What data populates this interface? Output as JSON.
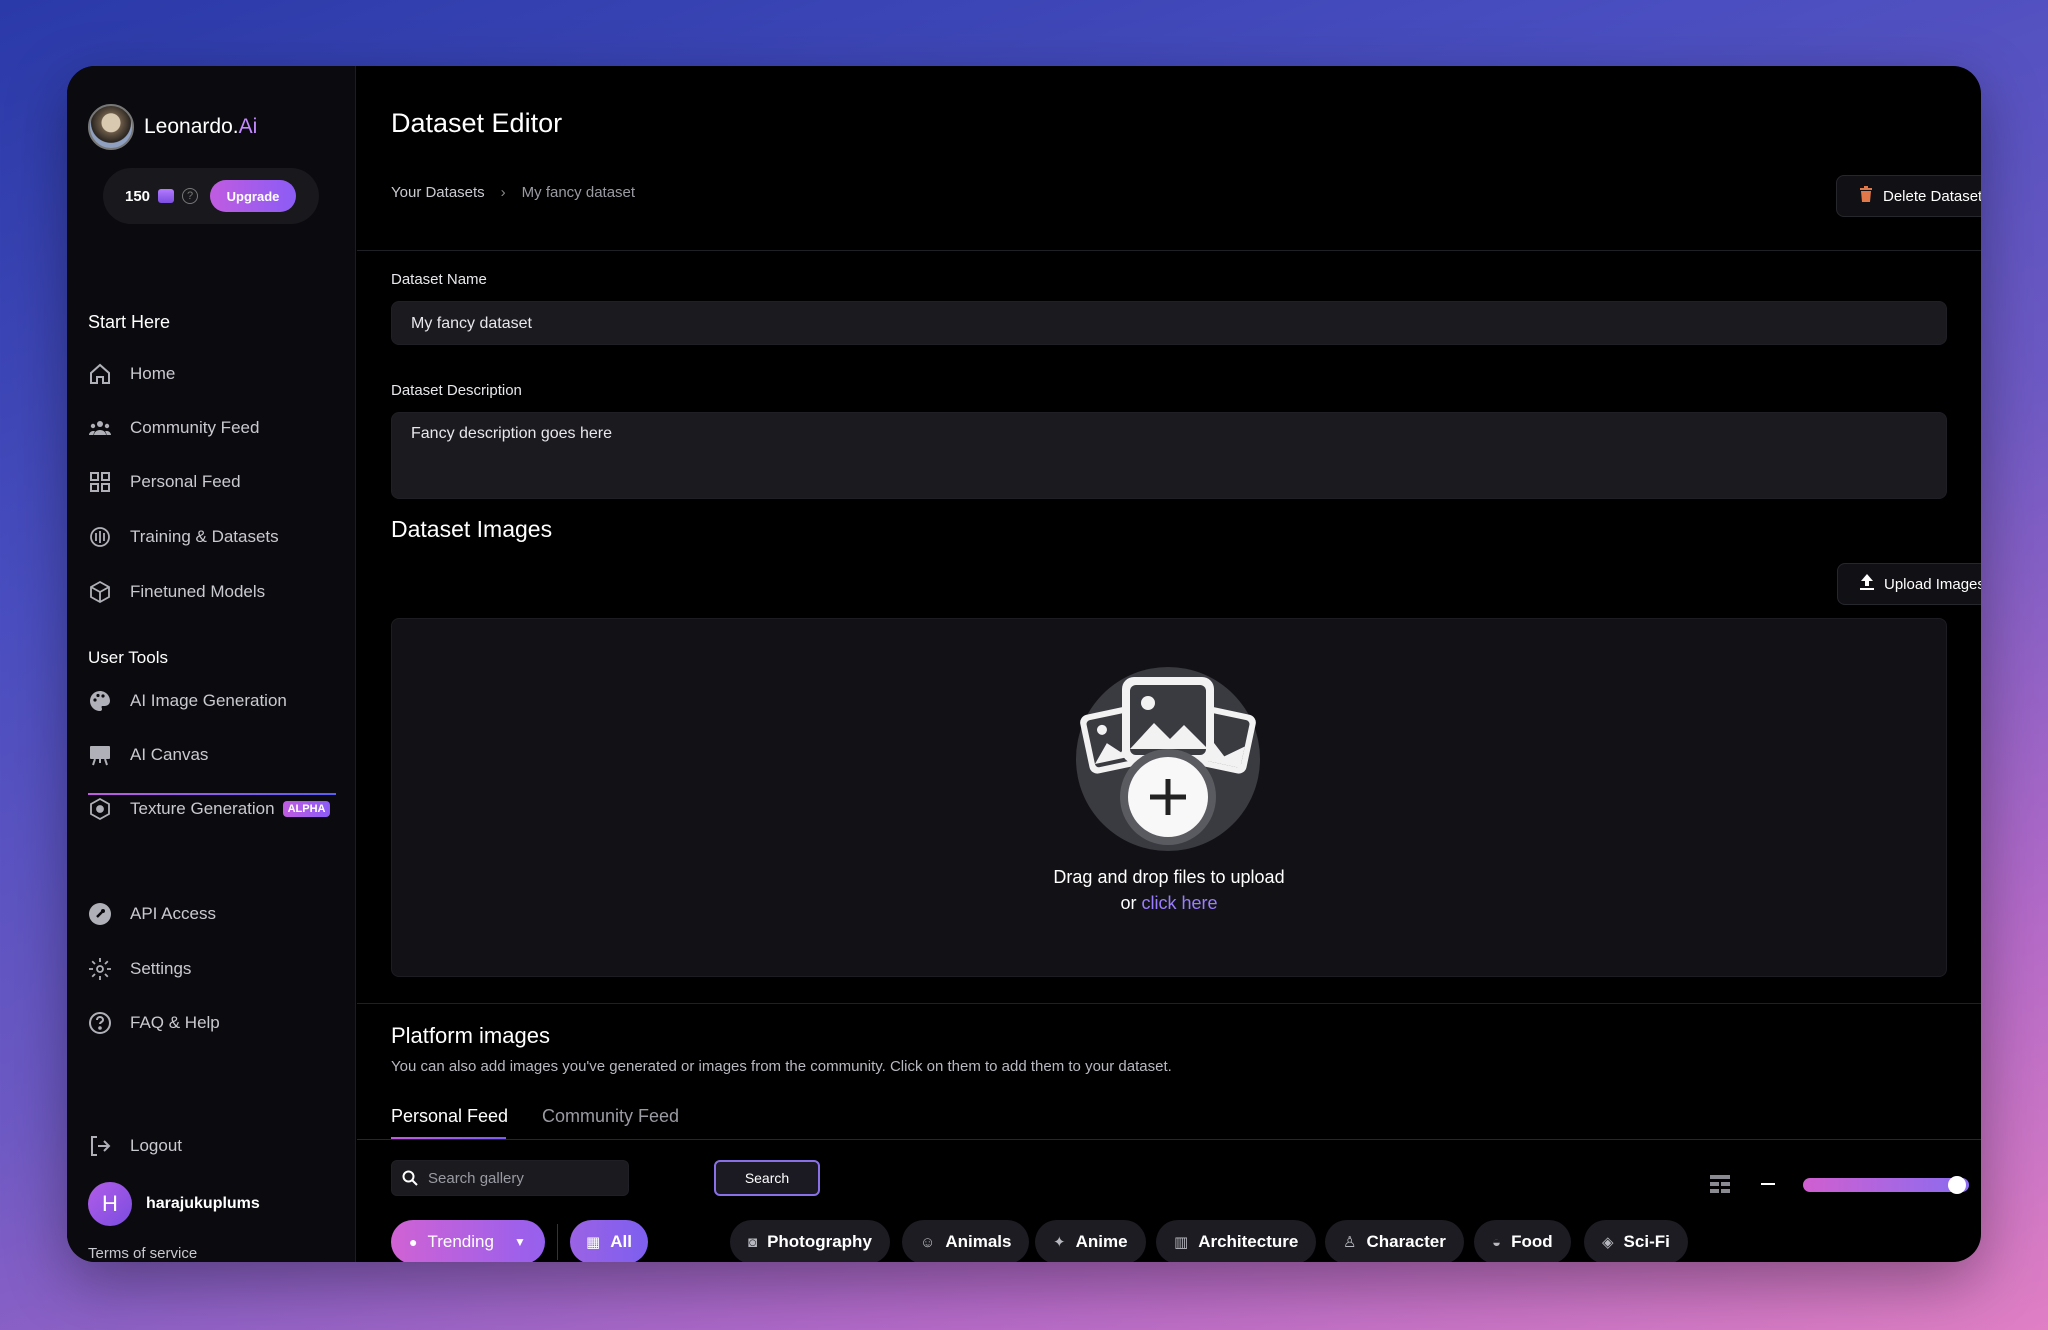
{
  "brand": {
    "name": "Leonardo.",
    "suffix": "Ai"
  },
  "credits": {
    "amount": "150",
    "upgrade_label": "Upgrade"
  },
  "sidebar": {
    "start_here_title": "Start Here",
    "start_items": [
      {
        "label": "Home",
        "icon": "home-icon"
      },
      {
        "label": "Community Feed",
        "icon": "people-icon"
      },
      {
        "label": "Personal Feed",
        "icon": "grid-icon"
      },
      {
        "label": "Training & Datasets",
        "icon": "training-icon"
      },
      {
        "label": "Finetuned Models",
        "icon": "cube-icon"
      }
    ],
    "user_tools_title": "User Tools",
    "tool_items": [
      {
        "label": "AI Image Generation",
        "icon": "palette-icon"
      },
      {
        "label": "AI Canvas",
        "icon": "canvas-icon"
      },
      {
        "label": "Texture Generation",
        "icon": "texture-icon",
        "badge": "ALPHA"
      }
    ],
    "bottom_items": [
      {
        "label": "API Access",
        "icon": "key-icon"
      },
      {
        "label": "Settings",
        "icon": "gear-icon"
      },
      {
        "label": "FAQ & Help",
        "icon": "help-icon"
      }
    ],
    "logout_label": "Logout",
    "user": {
      "initial": "H",
      "name": "harajukuplums"
    },
    "terms_label": "Terms of service"
  },
  "main": {
    "title": "Dataset Editor",
    "breadcrumb": {
      "root": "Your Datasets",
      "current": "My fancy dataset"
    },
    "delete_label": "Delete Dataset",
    "name_label": "Dataset Name",
    "name_value": "My fancy dataset",
    "description_label": "Dataset Description",
    "description_value": "Fancy description goes here",
    "images_title": "Dataset Images",
    "upload_label": "Upload Images",
    "dropzone_text": "Drag and drop files to upload",
    "dropzone_or": "or",
    "dropzone_link": "click here",
    "platform_title": "Platform images",
    "platform_subtitle": "You can also add images you've generated or images from the community. Click on them to add them to your dataset.",
    "tabs": [
      {
        "label": "Personal Feed",
        "active": true
      },
      {
        "label": "Community Feed",
        "active": false
      }
    ],
    "search_placeholder": "Search gallery",
    "search_button": "Search",
    "zoom_level": 0.9,
    "trending_label": "Trending",
    "chips": [
      "All",
      "Photography",
      "Animals",
      "Anime",
      "Architecture",
      "Character",
      "Food",
      "Sci-Fi"
    ]
  },
  "colors": {
    "accent": "#8b5cf6",
    "accent_pink": "#c05ce0",
    "link": "#9b7dff"
  }
}
